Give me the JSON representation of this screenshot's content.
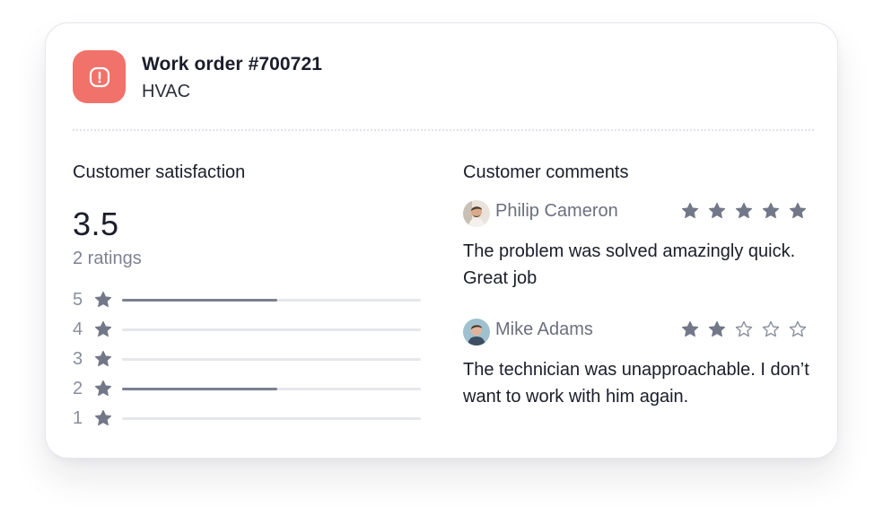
{
  "work_order": {
    "title": "Work order #700721",
    "category": "HVAC",
    "icon": "alert-icon",
    "icon_color": "#f0726a"
  },
  "satisfaction": {
    "heading": "Customer satisfaction",
    "score": "3.5",
    "ratings_label": "2 ratings",
    "distribution": [
      {
        "stars": "5",
        "fraction": 0.52
      },
      {
        "stars": "4",
        "fraction": 0
      },
      {
        "stars": "3",
        "fraction": 0
      },
      {
        "stars": "2",
        "fraction": 0.52
      },
      {
        "stars": "1",
        "fraction": 0
      }
    ]
  },
  "comments": {
    "heading": "Customer comments",
    "items": [
      {
        "name": "Philip Cameron",
        "rating": 5,
        "max_rating": 5,
        "text": "The problem was solved amazingly quick. Great job"
      },
      {
        "name": "Mike Adams",
        "rating": 2,
        "max_rating": 5,
        "text": "The technician was unapproachable. I don’t want to work with him again."
      }
    ]
  },
  "colors": {
    "star_filled": "#737889",
    "star_empty_stroke": "#8a8e9c",
    "bar_fill": "#7b8090",
    "bar_track": "#e6e7ec"
  }
}
